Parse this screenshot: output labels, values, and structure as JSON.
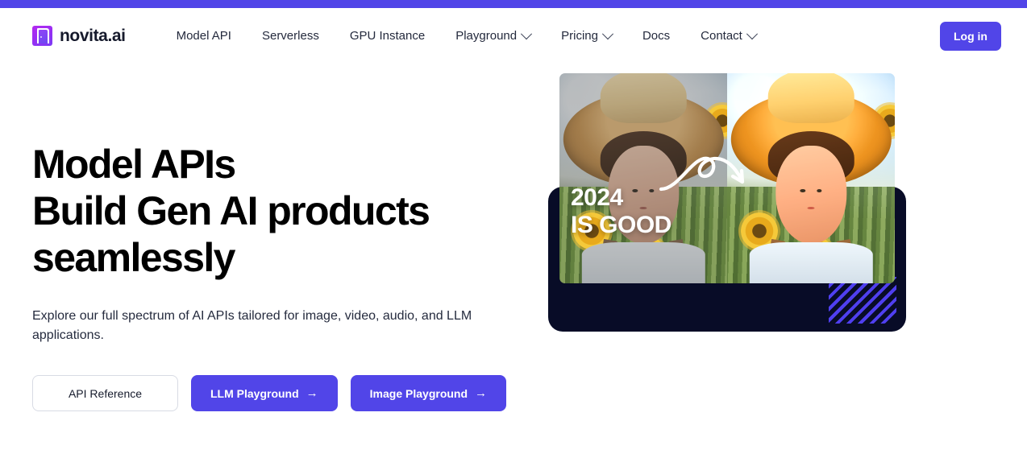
{
  "colors": {
    "accent": "#5145e8",
    "accent_stripe": "#4f3ff0",
    "dark_card": "#080c27",
    "text": "#1b2135",
    "logo_purple": "#b429f0"
  },
  "topbar": {
    "name": "accent-bar"
  },
  "header": {
    "brand": {
      "name": "novita.ai",
      "icon": "door-logo-icon"
    },
    "nav": [
      {
        "label": "Model API",
        "has_chevron": false
      },
      {
        "label": "Serverless",
        "has_chevron": false
      },
      {
        "label": "GPU Instance",
        "has_chevron": false
      },
      {
        "label": "Playground",
        "has_chevron": true
      },
      {
        "label": "Pricing",
        "has_chevron": true
      },
      {
        "label": "Docs",
        "has_chevron": false
      },
      {
        "label": "Contact",
        "has_chevron": true
      }
    ],
    "login_label": "Log in"
  },
  "hero": {
    "title_line1": "Model APIs",
    "title_line2": "Build Gen AI products",
    "title_line3": "seamlessly",
    "subtitle": "Explore our full spectrum of AI APIs tailored for image, video, audio, and LLM applications.",
    "buttons": [
      {
        "label": "API Reference",
        "style": "outline",
        "arrow": ""
      },
      {
        "label": "LLM Playground",
        "style": "primary",
        "arrow": "→"
      },
      {
        "label": "Image Playground",
        "style": "primary",
        "arrow": "→"
      }
    ],
    "visual": {
      "overlay_line1": "2024",
      "overlay_line2": "IS GOOD",
      "arrow_icon": "curved-arrow-icon",
      "before_label": "before-image",
      "after_label": "after-image"
    }
  }
}
